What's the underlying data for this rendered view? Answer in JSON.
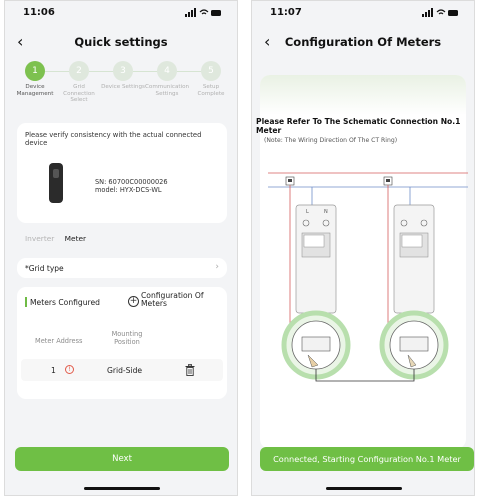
{
  "left": {
    "status_time": "11:06",
    "title": "Quick settings",
    "back_icon": "chevron-left-icon",
    "steps": [
      {
        "num": "1",
        "label": "Device Management"
      },
      {
        "num": "2",
        "label": "Grid Connection Select"
      },
      {
        "num": "3",
        "label": "Device Settings"
      },
      {
        "num": "4",
        "label": "Communication Settings"
      },
      {
        "num": "5",
        "label": "Setup Complete"
      }
    ],
    "verify_message": "Please verify consistency with the actual connected device",
    "device_sn": "SN: 60700C00000026",
    "device_model": "model: HYX-DCS-WL",
    "tabs": [
      "Inverter",
      "Meter"
    ],
    "grid_type_label": "*Grid type",
    "meters_configured_label": "Meters Configured",
    "configuration_label": "Configuration Of Meters",
    "table_headers": [
      "Meter Address",
      "Mounting Position"
    ],
    "meter_row": {
      "address": "1",
      "position": "Grid-Side"
    },
    "warning_icon": "!",
    "next_label": "Next"
  },
  "right": {
    "status_time": "11:07",
    "title": "Configuration Of Meters",
    "refer_text": "Please Refer To The Schematic Connection No.1 Meter",
    "note_text": "(Note: The Wiring Direction Of The CT Ring)",
    "meter_labels": [
      "L",
      "N"
    ],
    "status_button_label": "Connected, Starting Configuration No.1 Meter"
  },
  "colors": {
    "accent": "#6fbf45",
    "step_active": "#7dc14f",
    "warning": "#e25b4a"
  }
}
